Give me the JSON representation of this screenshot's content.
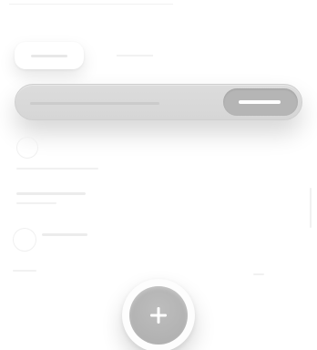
{
  "theme": {
    "background": "#ffffff",
    "surface_grey": "#d6d6d6",
    "action_grey": "#b5b5b5",
    "fab_grey": "#b0b0b0"
  },
  "icons": {
    "fab": "plus-icon"
  }
}
